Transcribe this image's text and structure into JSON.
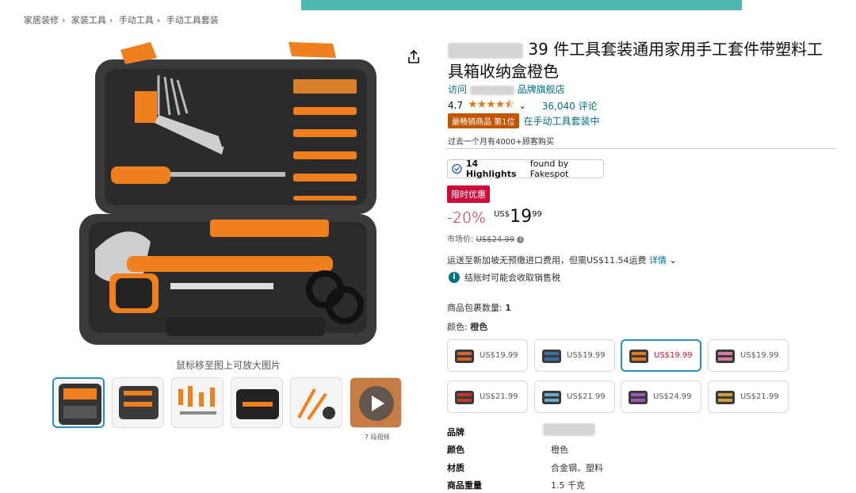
{
  "breadcrumb": [
    "家居装修",
    "家装工具",
    "手动工具",
    "手动工具套装"
  ],
  "image": {
    "hover_hint": "鼠标移至图上可放大图片",
    "video_label": "7 段视频"
  },
  "product": {
    "title": "39 件工具套装通用家用手工套件带塑料工具箱收纳盒橙色",
    "store_prefix": "访问",
    "store_suffix": "品牌旗舰店",
    "rating": "4.7",
    "stars": "★★★★⯪",
    "reviews": "36,040 评论",
    "best_seller_badge": "最畅销商品 第1位",
    "best_seller_category": "在手动工具套装中",
    "bought": "过去一个月有4000+顾客购买",
    "fakespot_count": "14 Highlights",
    "fakespot_suffix": "found by Fakespot",
    "deal_badge": "限时优惠",
    "discount": "-20%",
    "currency": "US$",
    "price_whole": "19",
    "price_fraction": "99",
    "list_price_label": "市场价:",
    "list_price": "US$24.99",
    "shipping_text": "运送至新加坡无预缴进口费用，但需US$11.54运费",
    "shipping_link": "详情",
    "tax_note": "结账时可能会收取销售税",
    "qty_label": "商品包裹数量:",
    "qty_value": "1",
    "color_label": "颜色:",
    "color_value": "橙色",
    "options": [
      {
        "price": "US$19.99",
        "accent": "#d4622a"
      },
      {
        "price": "US$19.99",
        "accent": "#3b6ea8"
      },
      {
        "price": "US$19.99",
        "accent": "#e07820",
        "selected": true
      },
      {
        "price": "US$19.99",
        "accent": "#d47aa8"
      },
      {
        "price": "US$21.99",
        "accent": "#c0392b"
      },
      {
        "price": "US$21.99",
        "accent": "#6aa9c9"
      },
      {
        "price": "US$24.99",
        "accent": "#9b59b6"
      },
      {
        "price": "US$21.99",
        "accent": "#c8a13a"
      }
    ],
    "specs": [
      {
        "key": "品牌",
        "value": ""
      },
      {
        "key": "颜色",
        "value": "橙色"
      },
      {
        "key": "材质",
        "value": "合金钢、塑料"
      },
      {
        "key": "商品重量",
        "value": "1.5 千克"
      }
    ]
  },
  "colors": {
    "link": "#007185",
    "deal": "#cc0c39",
    "orange": "#f07f1e",
    "selected_border": "#2a8fbd"
  }
}
